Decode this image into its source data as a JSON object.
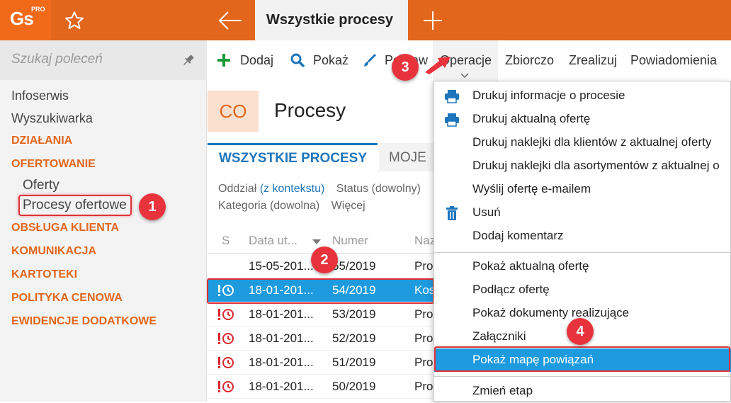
{
  "app": {
    "logo_text": "Gs",
    "logo_sup": "PRO",
    "active_tab": "Wszystkie procesy",
    "accent": "#e2661c",
    "blue": "#1e9adf"
  },
  "sidebar": {
    "search_placeholder": "Szukaj poleceń",
    "items": [
      {
        "label": "Infoserwis",
        "kind": "item"
      },
      {
        "label": "Wyszukiwarka",
        "kind": "item"
      },
      {
        "label": "DZIAŁANIA",
        "kind": "category"
      },
      {
        "label": "OFERTOWANIE",
        "kind": "category"
      },
      {
        "label": "Oferty",
        "kind": "sub"
      },
      {
        "label": "Procesy ofertowe",
        "kind": "sub"
      },
      {
        "label": "OBSŁUGA KLIENTA",
        "kind": "category"
      },
      {
        "label": "KOMUNIKACJA",
        "kind": "category"
      },
      {
        "label": "KARTOTEKI",
        "kind": "category"
      },
      {
        "label": "POLITYKA CENOWA",
        "kind": "category"
      },
      {
        "label": "EWIDENCJE DODATKOWE",
        "kind": "category"
      }
    ]
  },
  "toolbar": {
    "add": "Dodaj",
    "show": "Pokaż",
    "edit": "Popraw",
    "operations": "Operacje",
    "summary": "Zbiorczo",
    "realize": "Zrealizuj",
    "notifications": "Powiadomienia"
  },
  "main": {
    "badge": "CO",
    "title": "Procesy",
    "tabs": [
      "WSZYSTKIE PROCESY",
      "MOJE"
    ],
    "filters": {
      "branch_label": "Oddział",
      "branch_value": "(z kontekstu)",
      "status": "Status (dowolny)",
      "category": "Kategoria (dowolna)",
      "more": "Więcej"
    },
    "columns": [
      "S",
      "Data ut...",
      "Numer",
      "Naz"
    ],
    "rows": [
      {
        "date": "15-05-201...",
        "number": "55/2019",
        "name": "Pro",
        "alert": false,
        "selected": false
      },
      {
        "date": "18-01-201...",
        "number": "54/2019",
        "name": "Kos",
        "alert": true,
        "selected": true
      },
      {
        "date": "18-01-201...",
        "number": "53/2019",
        "name": "Pro",
        "alert": true,
        "selected": false
      },
      {
        "date": "18-01-201...",
        "number": "52/2019",
        "name": "Pro",
        "alert": true,
        "selected": false
      },
      {
        "date": "18-01-201...",
        "number": "51/2019",
        "name": "Pro",
        "alert": true,
        "selected": false
      },
      {
        "date": "18-01-201...",
        "number": "50/2019",
        "name": "Pro",
        "alert": true,
        "selected": false
      }
    ]
  },
  "menu": {
    "items": [
      {
        "label": "Drukuj informacje o procesie",
        "icon": "printer-icon"
      },
      {
        "label": "Drukuj aktualną ofertę",
        "icon": "printer-icon"
      },
      {
        "label": "Drukuj naklejki dla klientów z aktualnej oferty",
        "icon": ""
      },
      {
        "label": "Drukuj naklejki dla asortymentów z aktualnej o",
        "icon": ""
      },
      {
        "label": "Wyślij ofertę e-mailem",
        "icon": ""
      },
      {
        "label": "Usuń",
        "icon": "trash-icon"
      },
      {
        "label": "Dodaj komentarz",
        "icon": ""
      },
      {
        "label": "Pokaż aktualną ofertę",
        "icon": ""
      },
      {
        "label": "Podłącz ofertę",
        "icon": ""
      },
      {
        "label": "Pokaż dokumenty realizujące",
        "icon": ""
      },
      {
        "label": "Załączniki",
        "icon": ""
      },
      {
        "label": "Pokaż mapę powiązań",
        "icon": ""
      },
      {
        "label": "Zmień etap",
        "icon": ""
      }
    ]
  },
  "callouts": [
    "1",
    "2",
    "3",
    "4"
  ]
}
